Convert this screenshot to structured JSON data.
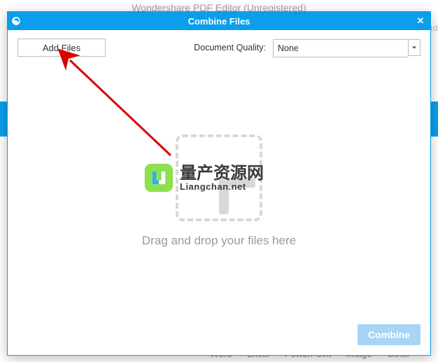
{
  "background": {
    "parent_title": "Wondershare PDF Editor (Unregistered)",
    "right_fragment": "nd",
    "convert_row": [
      "Word",
      "Excel",
      "PowerPoint",
      "Image",
      "Other"
    ]
  },
  "dialog": {
    "title": "Combine Files",
    "close_symbol": "✕",
    "add_files_label": "Add Files",
    "quality_label": "Document Quality:",
    "quality_value": "None",
    "drop_text": "Drag and drop your files here",
    "combine_label": "Combine"
  },
  "watermark": {
    "cn": "量产资源网",
    "en": "Liangchan.net"
  },
  "colors": {
    "accent": "#0a9eec",
    "disabled_btn": "#a8d5f5",
    "anno_red": "#d90000"
  }
}
